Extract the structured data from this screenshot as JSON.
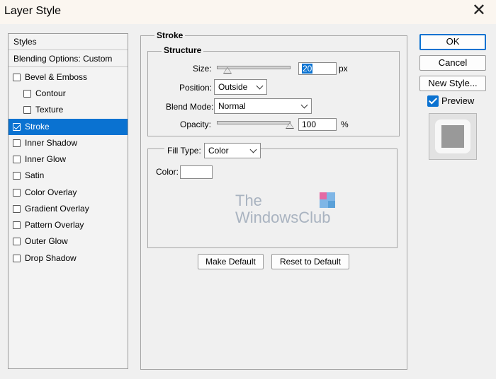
{
  "window": {
    "title": "Layer Style"
  },
  "styles_panel": {
    "header": "Styles",
    "blending": "Blending Options: Custom",
    "items": [
      {
        "label": "Bevel & Emboss",
        "checked": false
      },
      {
        "label": "Contour",
        "checked": false
      },
      {
        "label": "Texture",
        "checked": false
      },
      {
        "label": "Stroke",
        "checked": true,
        "selected": true
      },
      {
        "label": "Inner Shadow",
        "checked": false
      },
      {
        "label": "Inner Glow",
        "checked": false
      },
      {
        "label": "Satin",
        "checked": false
      },
      {
        "label": "Color Overlay",
        "checked": false
      },
      {
        "label": "Gradient Overlay",
        "checked": false
      },
      {
        "label": "Pattern Overlay",
        "checked": false
      },
      {
        "label": "Outer Glow",
        "checked": false
      },
      {
        "label": "Drop Shadow",
        "checked": false
      }
    ]
  },
  "stroke": {
    "group_title": "Stroke",
    "structure_title": "Structure",
    "size_label": "Size:",
    "size_value": "20",
    "size_unit": "px",
    "position_label": "Position:",
    "position_value": "Outside",
    "blend_label": "Blend Mode:",
    "blend_value": "Normal",
    "opacity_label": "Opacity:",
    "opacity_value": "100",
    "opacity_unit": "%",
    "fill_type_label": "Fill Type:",
    "fill_type_value": "Color",
    "color_label": "Color:",
    "stroke_color": "#ffffff",
    "make_default": "Make Default",
    "reset_default": "Reset to Default"
  },
  "buttons": {
    "ok": "OK",
    "cancel": "Cancel",
    "new_style": "New Style...",
    "preview": "Preview",
    "preview_checked": true
  },
  "watermark": {
    "line1": "The",
    "line2": "WindowsClub"
  },
  "colors": {
    "accent": "#0a72d1",
    "watermark": "#a9b3c0"
  }
}
